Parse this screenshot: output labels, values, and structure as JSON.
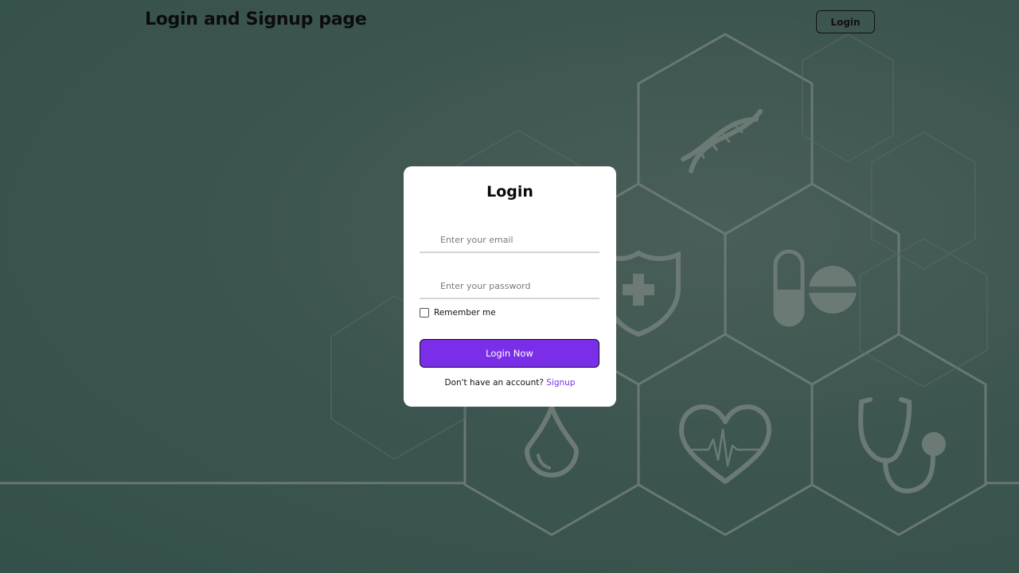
{
  "header": {
    "title": "Login and Signup page",
    "login_label": "Login"
  },
  "form": {
    "title": "Login",
    "email_placeholder": "Enter your email",
    "email_value": "",
    "password_placeholder": "Enter your password",
    "password_value": "",
    "remember_label": "Remember me",
    "remember_checked": false,
    "submit_label": "Login Now",
    "signup_prompt": "Don't have an account?",
    "signup_link": "Signup"
  },
  "background": {
    "icons": [
      "dna-icon",
      "shield-cross-icon",
      "pill-icon",
      "blood-drop-icon",
      "heartbeat-icon",
      "stethoscope-icon"
    ]
  },
  "colors": {
    "accent": "#7a2ee8",
    "background": "#3d5550",
    "card": "#ffffff"
  }
}
